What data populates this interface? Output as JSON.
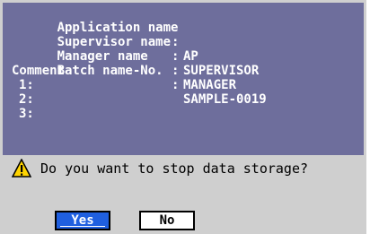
{
  "dialog": {
    "fields": [
      {
        "label": "Application name",
        "separator": ":",
        "value": "AP"
      },
      {
        "label": "Supervisor name",
        "separator": ":",
        "value": "SUPERVISOR"
      },
      {
        "label": "Manager name",
        "separator": ":",
        "value": "MANAGER"
      },
      {
        "label": "Batch name-No.",
        "separator": ":",
        "value": "SAMPLE-0019"
      }
    ],
    "comment_label": "Comment",
    "comment_lines": [
      "1:",
      "2:",
      "3:"
    ],
    "prompt": "Do you want to stop data storage?",
    "icon": "warning-icon",
    "yes_label": "Yes",
    "no_label": "No"
  },
  "colors": {
    "panel": "#6e6e9c",
    "background": "#cfcfcf",
    "yes_button": "#1f5fe0",
    "warning": "#ffd400"
  }
}
